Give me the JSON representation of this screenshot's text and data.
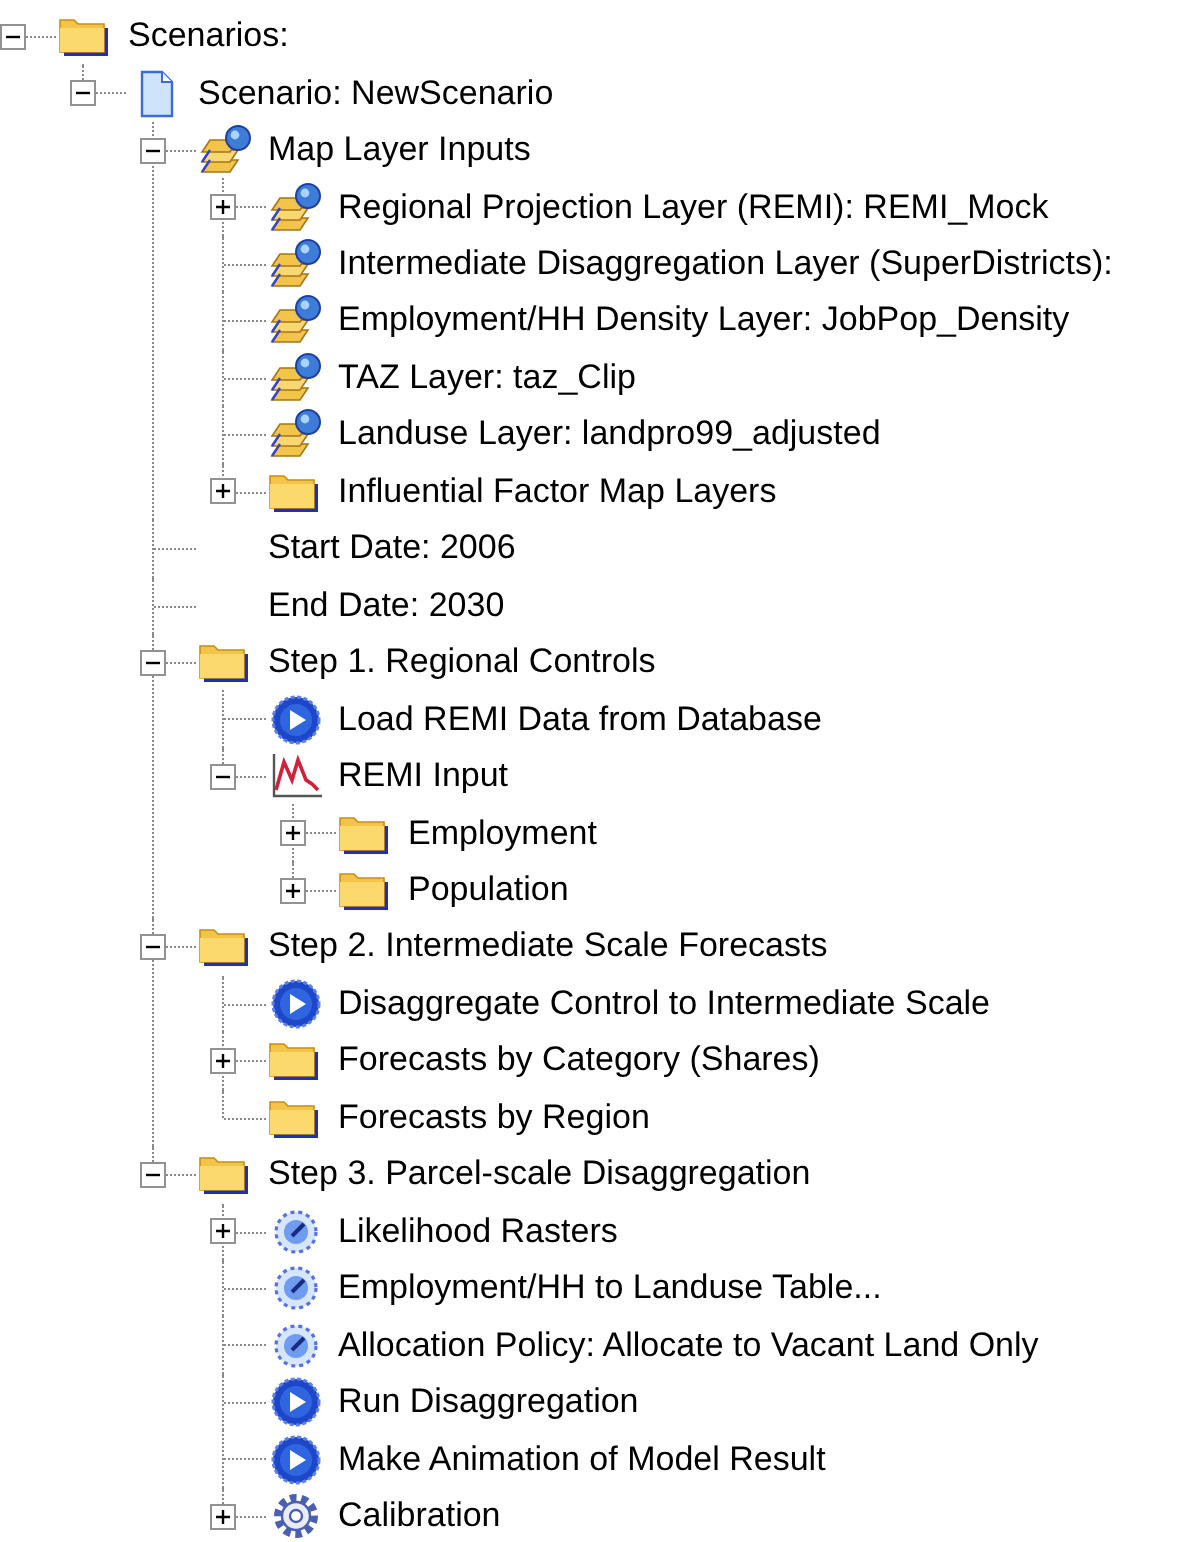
{
  "tree": {
    "label": "Scenarios:",
    "kind": "folder",
    "expanded": true,
    "children": [
      {
        "label": "Scenario: NewScenario",
        "kind": "document",
        "expanded": true,
        "children": [
          {
            "label": "Map Layer Inputs",
            "kind": "layers",
            "expanded": true,
            "children": [
              {
                "label": "Regional Projection Layer (REMI): REMI_Mock",
                "kind": "layers",
                "expanded": false
              },
              {
                "label": "Intermediate Disaggregation Layer (SuperDistricts):",
                "kind": "layers"
              },
              {
                "label": "Employment/HH Density Layer: JobPop_Density",
                "kind": "layers"
              },
              {
                "label": "TAZ Layer: taz_Clip",
                "kind": "layers"
              },
              {
                "label": "Landuse Layer: landpro99_adjusted",
                "kind": "layers"
              },
              {
                "label": "Influential Factor Map Layers",
                "kind": "folder",
                "expanded": false
              }
            ]
          },
          {
            "label": "Start Date: 2006",
            "kind": "none"
          },
          {
            "label": "End Date: 2030",
            "kind": "none"
          },
          {
            "label": "Step 1. Regional Controls",
            "kind": "folder",
            "expanded": true,
            "children": [
              {
                "label": "Load REMI Data from Database",
                "kind": "run"
              },
              {
                "label": "REMI Input",
                "kind": "chart",
                "expanded": true,
                "children": [
                  {
                    "label": "Employment",
                    "kind": "folder",
                    "expanded": false
                  },
                  {
                    "label": "Population",
                    "kind": "folder",
                    "expanded": false
                  }
                ]
              }
            ]
          },
          {
            "label": "Step 2. Intermediate Scale Forecasts",
            "kind": "folder",
            "expanded": true,
            "children": [
              {
                "label": "Disaggregate Control to Intermediate Scale",
                "kind": "run"
              },
              {
                "label": "Forecasts by Category (Shares)",
                "kind": "folder",
                "expanded": false
              },
              {
                "label": "Forecasts by Region",
                "kind": "folder"
              }
            ]
          },
          {
            "label": "Step 3. Parcel-scale Disaggregation",
            "kind": "folder",
            "expanded": true,
            "children": [
              {
                "label": "Likelihood Rasters",
                "kind": "gauge",
                "expanded": false
              },
              {
                "label": "Employment/HH to Landuse Table...",
                "kind": "gauge"
              },
              {
                "label": "Allocation Policy: Allocate to Vacant Land Only",
                "kind": "gauge"
              },
              {
                "label": "Run Disaggregation",
                "kind": "run"
              },
              {
                "label": "Make Animation of Model Result",
                "kind": "run"
              },
              {
                "label": "Calibration",
                "kind": "gear",
                "expanded": false
              }
            ]
          }
        ]
      }
    ]
  }
}
